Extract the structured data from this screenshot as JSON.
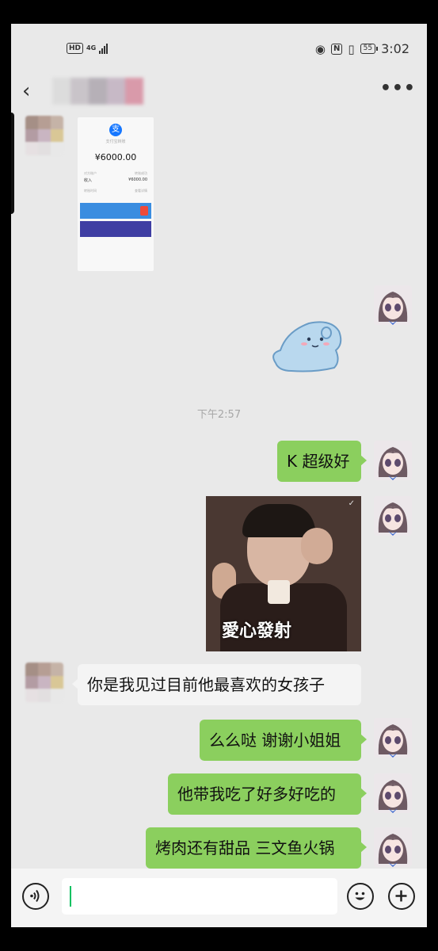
{
  "status_bar": {
    "hd": "HD",
    "network": "4G",
    "battery": "55",
    "time": "3:02"
  },
  "header": {
    "back_icon": "back-arrow-icon",
    "title": "",
    "more_label": "•••"
  },
  "messages": {
    "transfer": {
      "app_label": "支付宝转账",
      "amount": "¥6000.00",
      "status_label": "转账成功",
      "account": "对方账户",
      "payee": "收入",
      "received": "¥6000.00",
      "row_a": "转账时间",
      "row_b": "查看详情"
    },
    "timestamp": "下午2:57",
    "msg_1": "K 超级好",
    "photo_caption": "愛心發射",
    "msg_2": "你是我见过目前他最喜欢的女孩子",
    "msg_3": "么么哒 谢谢小姐姐",
    "msg_4": "他带我吃了好多好吃的",
    "msg_5": "烤肉还有甜品 三文鱼火锅"
  },
  "input_bar": {
    "voice_icon": "voice-input-icon",
    "placeholder": "",
    "emoji_icon": "emoji-icon",
    "plus_icon": "plus-icon"
  },
  "colors": {
    "my_bubble": "#8bcf5e",
    "their_bubble": "#f4f4f4",
    "background": "#e9e9e9",
    "cursor": "#07c160"
  }
}
